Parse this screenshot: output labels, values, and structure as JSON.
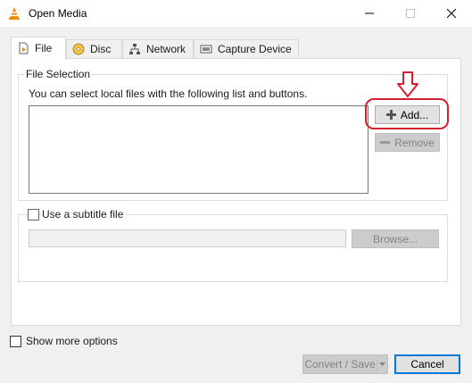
{
  "window": {
    "title": "Open Media",
    "minimize_icon": "minimize-icon",
    "maximize_icon": "maximize-icon",
    "close_icon": "close-icon"
  },
  "tabs": [
    {
      "label": "File",
      "icon": "file-icon",
      "active": true
    },
    {
      "label": "Disc",
      "icon": "disc-icon",
      "active": false
    },
    {
      "label": "Network",
      "icon": "network-icon",
      "active": false
    },
    {
      "label": "Capture Device",
      "icon": "capture-device-icon",
      "active": false
    }
  ],
  "file_selection": {
    "group_title": "File Selection",
    "description": "You can select local files with the following list and buttons.",
    "add_label": "Add...",
    "remove_label": "Remove"
  },
  "subtitle": {
    "checkbox_label": "Use a subtitle file",
    "checked": false,
    "path_value": "",
    "browse_label": "Browse..."
  },
  "footer": {
    "show_more_label": "Show more options",
    "show_more_checked": false,
    "convert_label": "Convert / Save",
    "cancel_label": "Cancel"
  },
  "colors": {
    "annotation_red": "#d6202f",
    "vlc_orange": "#f08a00"
  }
}
